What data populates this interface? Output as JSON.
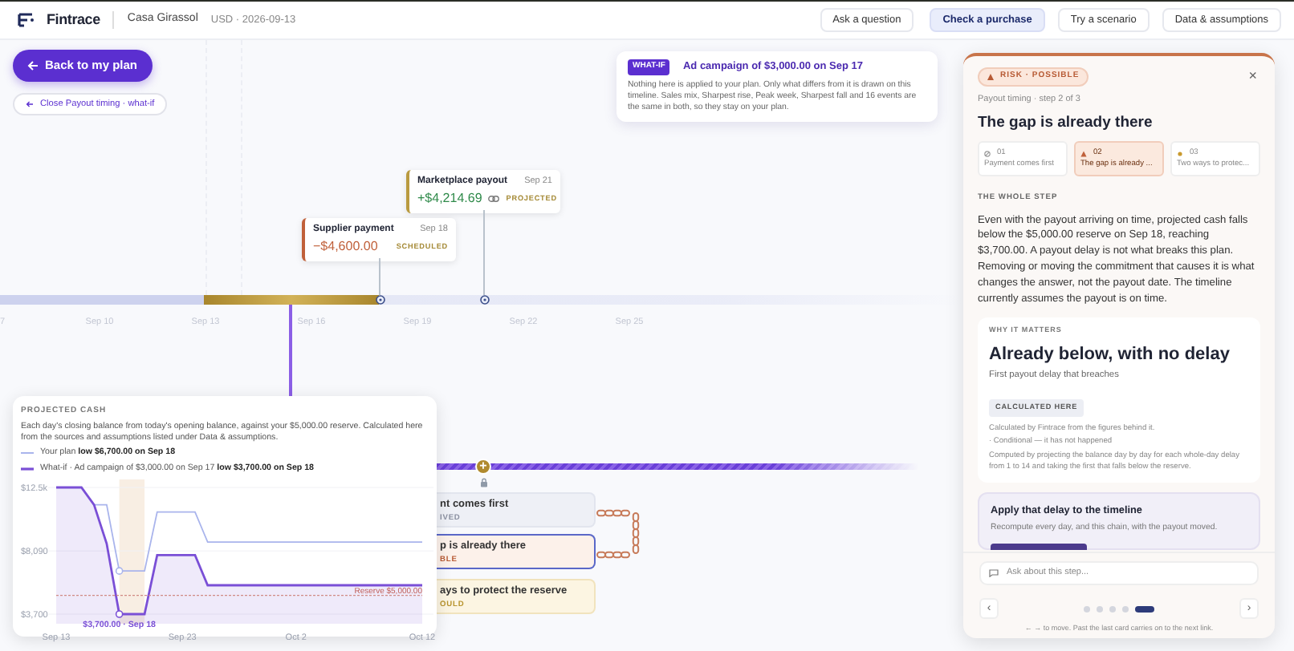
{
  "topbar": {
    "brand": "Fintrace",
    "workspace": "Casa Girassol",
    "meta": "USD · 2026-09-13",
    "actions": [
      {
        "label": "Ask a question",
        "selected": false
      },
      {
        "label": "Check a purchase",
        "selected": true
      },
      {
        "label": "Try a scenario",
        "selected": false
      },
      {
        "label": "Data & assumptions",
        "selected": false
      }
    ]
  },
  "back_button": "Back to my plan",
  "close_chip": "Close Payout timing · what-if",
  "whatif_card": {
    "tag": "WHAT-IF",
    "title": "Ad campaign of $3,000.00 on Sep 17",
    "text": "Nothing here is applied to your plan. Only what differs from it is drawn on this timeline. Sales mix, Sharpest rise, Peak week, Sharpest fall and 16 events are the same in both, so they stay on your plan."
  },
  "timeline": {
    "ticks": [
      "7",
      "Sep 10",
      "Sep 13",
      "Sep 16",
      "Sep 19",
      "Sep 22",
      "Sep 25"
    ],
    "events": [
      {
        "title": "Marketplace payout",
        "date": "Sep 21",
        "amount": "+$4,214.69",
        "status": "PROJECTED",
        "kind": "inflow"
      },
      {
        "title": "Supplier payment",
        "date": "Sep 18",
        "amount": "−$4,600.00",
        "status": "SCHEDULED",
        "kind": "outflow"
      }
    ],
    "plus_node": "+",
    "chain": [
      {
        "title": "nt comes first",
        "status": "IVED",
        "kind": "done",
        "selected": false
      },
      {
        "title": "p is already there",
        "status": "BLE",
        "kind": "risk",
        "selected": true
      },
      {
        "title": "ays to protect the reserve",
        "status": "OULD",
        "kind": "could",
        "selected": false
      }
    ]
  },
  "projected_cash": {
    "title": "PROJECTED CASH",
    "text": "Each day's closing balance from today's opening balance, against your $5,000.00 reserve. Calculated here from the sources and assumptions listed under Data & assumptions.",
    "legend_notes": [
      "low $6,700.00 on Sep 18",
      "low $3,700.00 on Sep 18"
    ],
    "chart_data": {
      "type": "line",
      "categories": [
        "Sep 13",
        null,
        null,
        null,
        null,
        null,
        null,
        null,
        null,
        null,
        "Sep 23",
        null,
        null,
        null,
        null,
        null,
        null,
        null,
        null,
        "Oct 2",
        null,
        null,
        null,
        null,
        null,
        null,
        null,
        null,
        null,
        "Oct 12"
      ],
      "ylim": [
        3700,
        12500
      ],
      "yticks": [
        {
          "value": 12500,
          "label": "$12.5k"
        },
        {
          "value": 8090,
          "label": "$8,090"
        },
        {
          "value": 3700,
          "label": "$3,700"
        }
      ],
      "series": [
        {
          "name": "Your plan",
          "color": "#a9b4ec",
          "values": [
            12500,
            12500,
            12500,
            11300,
            11300,
            6700,
            6700,
            6700,
            10800,
            10800,
            10800,
            10800,
            8700,
            8700,
            8700,
            8700,
            8700,
            8700,
            8700,
            8700,
            8700,
            8700,
            8700,
            8700,
            8700,
            8700,
            8700,
            8700,
            8700,
            8700
          ]
        },
        {
          "name": "What-if · Ad campaign of $3,000.00 on Sep 17",
          "color": "#7a4fd6",
          "type": "area",
          "values": [
            12500,
            12500,
            12500,
            11300,
            8600,
            3700,
            3700,
            3700,
            7800,
            7800,
            7800,
            7800,
            5700,
            5700,
            5700,
            5700,
            5700,
            5700,
            5700,
            5700,
            5700,
            5700,
            5700,
            5700,
            5700,
            5700,
            5700,
            5700,
            5700,
            5700
          ]
        }
      ],
      "ref_lines": [
        {
          "axis": "y",
          "value": 5000,
          "label": "Reserve $5,000.00"
        }
      ],
      "annotations": [
        {
          "y": 3700,
          "text": "$3,700.00 · Sep 18"
        }
      ]
    }
  },
  "step_panel": {
    "risk": "RISK · POSSIBLE",
    "close": "×",
    "crumb": "Payout timing · step 2 of 3",
    "title": "The gap is already there",
    "steps": [
      {
        "number": "01",
        "label": "Payment comes first",
        "kind": "done",
        "selected": false
      },
      {
        "number": "02",
        "label": "The gap is already ...",
        "kind": "risk",
        "selected": true
      },
      {
        "number": "03",
        "label": "Two ways to protec...",
        "kind": "could",
        "selected": false
      }
    ],
    "section": "THE WHOLE STEP",
    "text": "Even with the payout arriving on time, projected cash falls below the $5,000.00 reserve on Sep 18, reaching $3,700.00. A payout delay is not what breaks this plan. Removing or moving the commitment that causes it is what changes the answer, not the payout date. The timeline currently assumes the payout is on time.",
    "why": {
      "label": "WHY IT MATTERS",
      "headline": "Already below, with no delay",
      "sub": "First payout delay that breaches",
      "badge": "CALCULATED HERE",
      "source": "Calculated by Fintrace from the figures behind it.",
      "condition": "· Conditional — it has not happened",
      "method": "Computed by projecting the balance day by day for each whole-day delay from 1 to 14 and taking the first that falls below the reserve."
    },
    "apply": {
      "title": "Apply that delay to the timeline",
      "text": "Recompute every day, and this chain, with the payout moved."
    },
    "ask_placeholder": "Ask about this step...",
    "prev": "‹",
    "next": "›",
    "pager": [
      {
        "selected": false
      },
      {
        "selected": false
      },
      {
        "selected": false
      },
      {
        "selected": false
      },
      {
        "selected": true
      }
    ],
    "hint": "← → to move. Past the last card carries on to the next link."
  }
}
